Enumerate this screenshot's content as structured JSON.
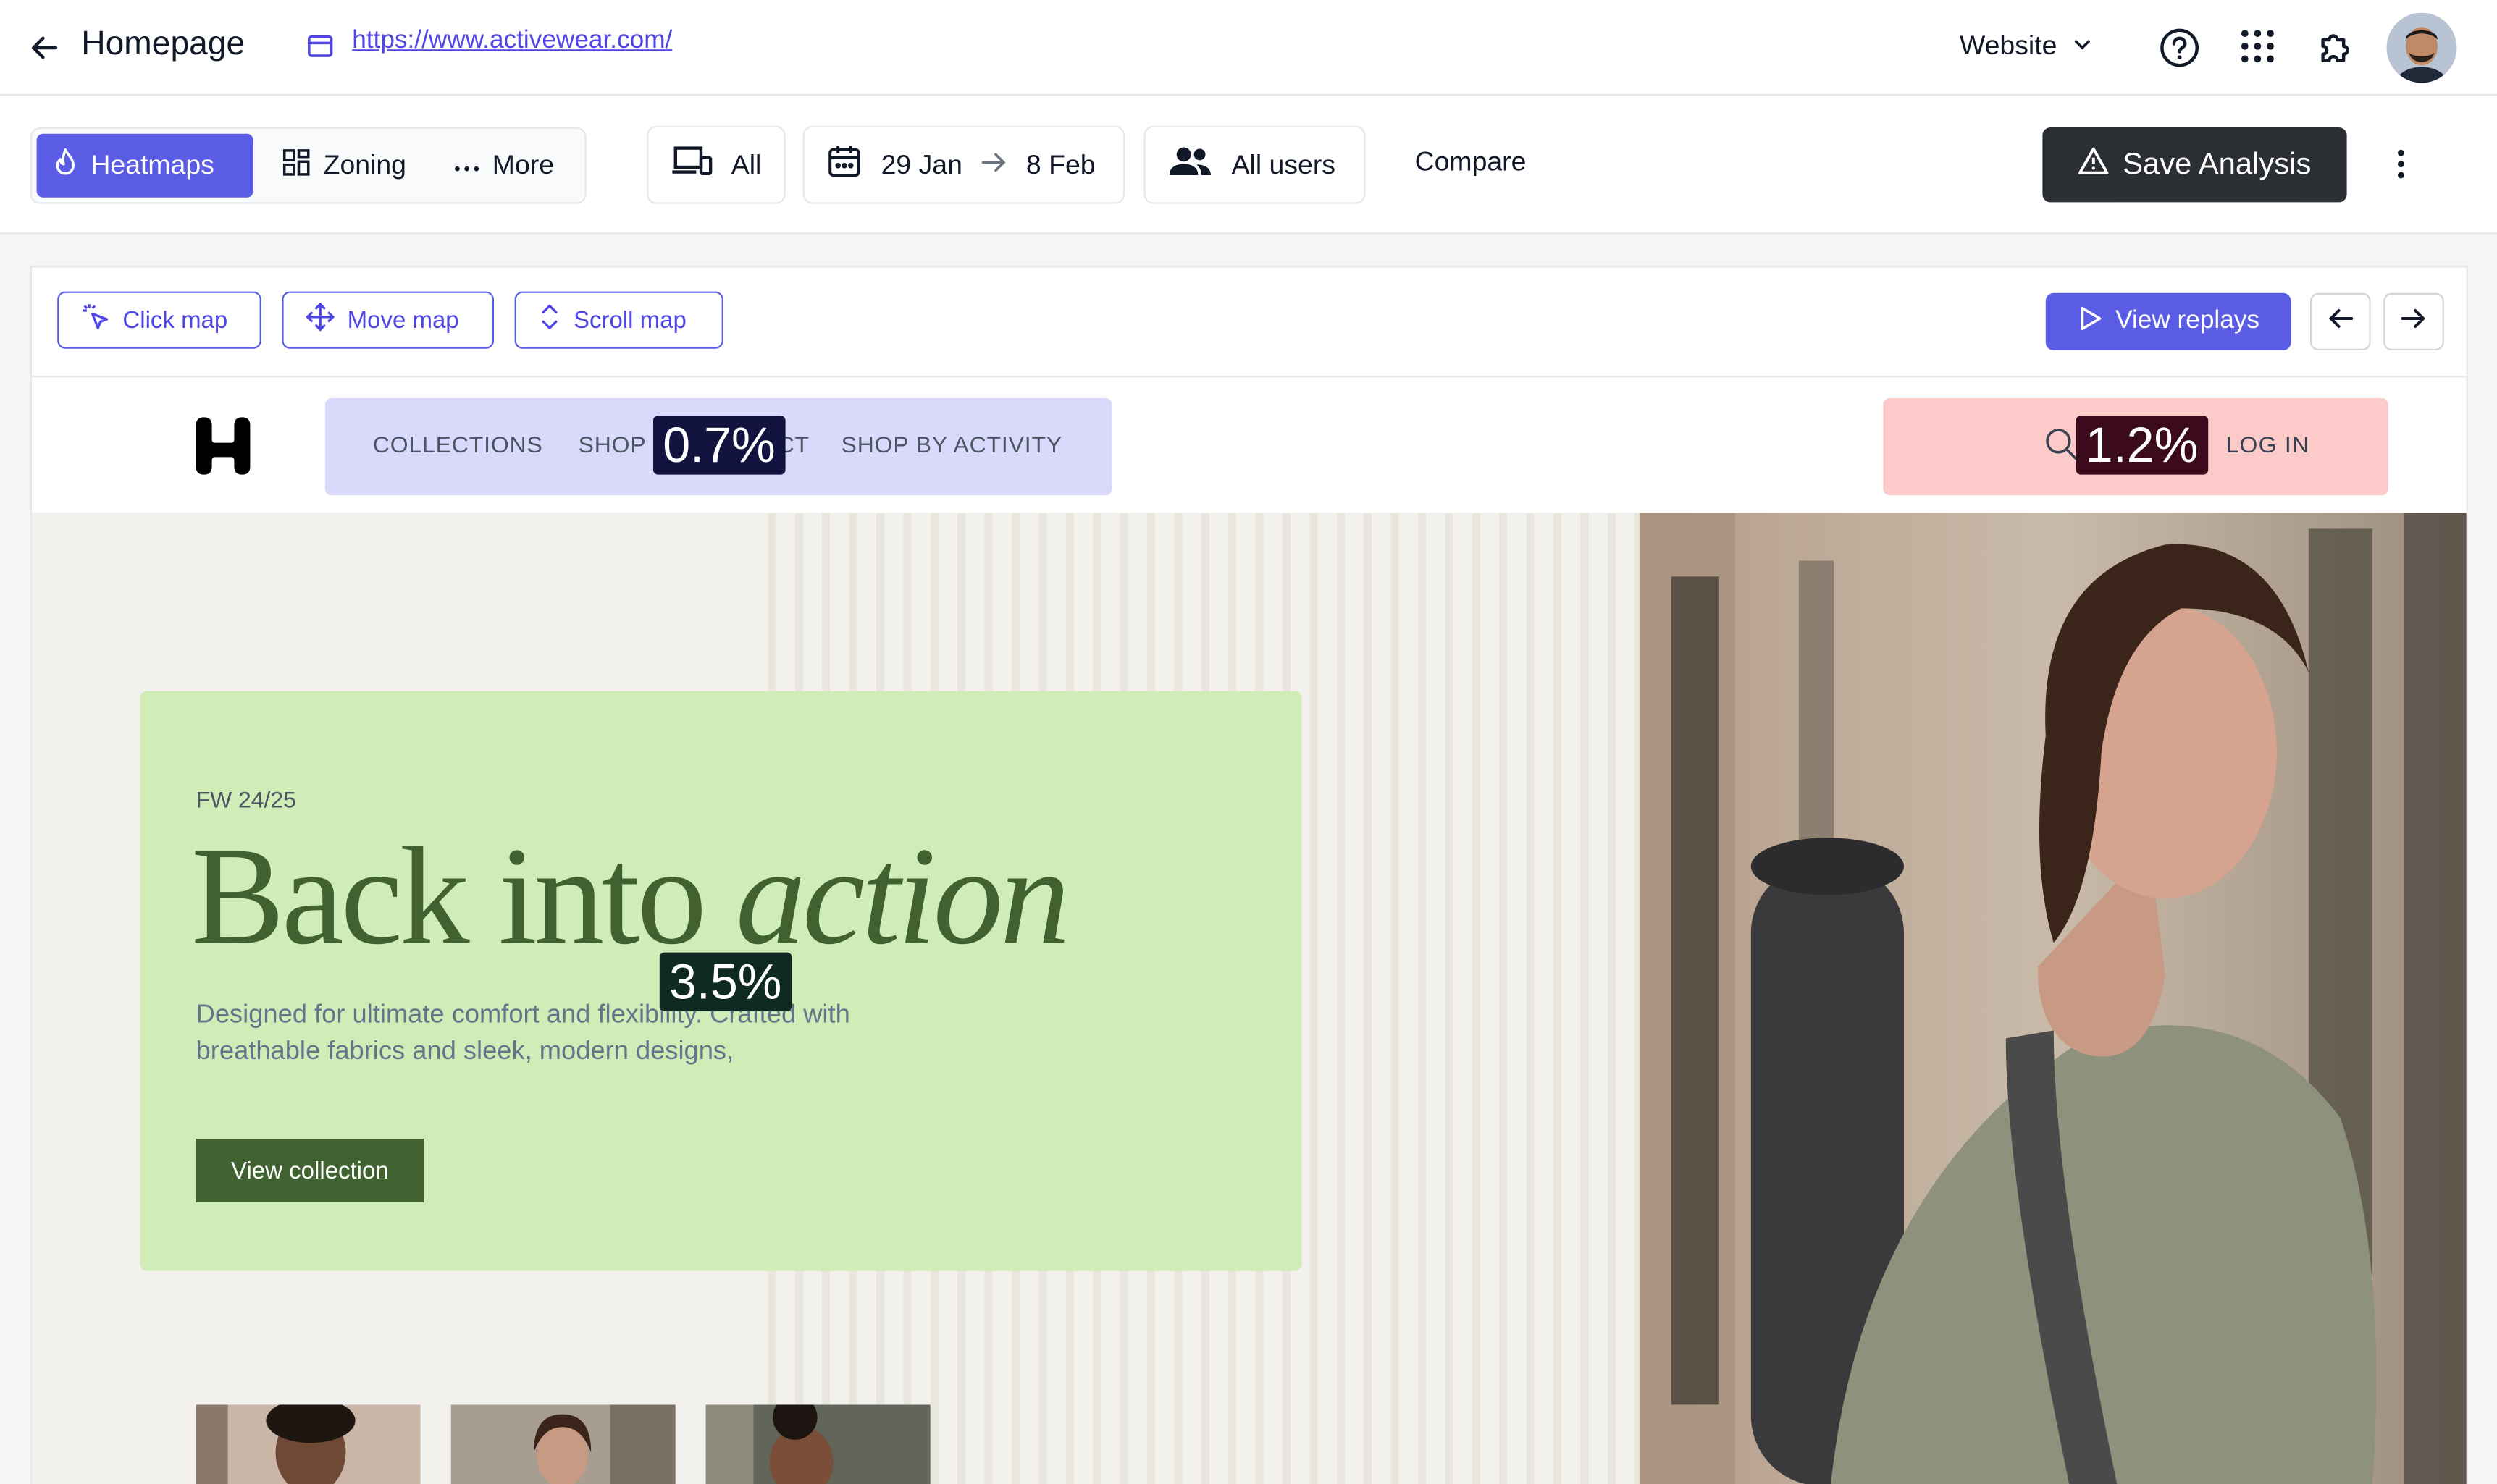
{
  "topbar": {
    "page_title": "Homepage",
    "url": "https://www.activewear.com/",
    "site_selector": "Website"
  },
  "toolbar": {
    "view_tabs": [
      {
        "label": "Heatmaps",
        "active": true
      },
      {
        "label": "Zoning",
        "active": false
      },
      {
        "label": "More",
        "active": false
      }
    ],
    "device_filter": "All",
    "date_start": "29 Jan",
    "date_end": "8 Feb",
    "segment_filter": "All users",
    "compare_label": "Compare",
    "save_label": "Save Analysis"
  },
  "heatmap_bar": {
    "modes": [
      {
        "label": "Click map"
      },
      {
        "label": "Move map"
      },
      {
        "label": "Scroll map"
      }
    ],
    "view_replays_label": "View replays"
  },
  "website": {
    "nav": {
      "items": [
        "COLLECTIONS",
        "SHOP",
        "CT",
        "SHOP BY ACTIVITY"
      ],
      "login_label": "LOG IN"
    },
    "hero": {
      "eyebrow": "FW 24/25",
      "headline_regular": "Back into",
      "headline_italic": "action",
      "subcopy": "Designed for ultimate comfort and flexibility. Crafted with breathable fabrics and sleek, modern designs,",
      "cta_label": "View collection"
    }
  },
  "heatmap_badges": [
    {
      "zone": "navigation",
      "value": "0.7%",
      "color": "#13133f"
    },
    {
      "zone": "login",
      "value": "1.2%",
      "color": "#3b0a1c"
    },
    {
      "zone": "hero",
      "value": "3.5%",
      "color": "#0e2a22"
    }
  ],
  "colors": {
    "accent": "#5b5ce6",
    "save_button": "#2b2f33",
    "hero_green": "#3f6230",
    "zone_nav": "#d8d9fb",
    "zone_login": "#fdcaca",
    "zone_hero": "#d1edb7"
  },
  "icons": {
    "back": "arrow-left-icon",
    "url": "browser-window-icon",
    "help": "question-circle-icon",
    "apps": "grid-dots-icon",
    "extensions": "puzzle-icon",
    "heatmaps": "flame-icon",
    "zoning": "zones-grid-icon",
    "more": "ellipsis-icon",
    "device": "devices-icon",
    "date": "calendar-icon",
    "users": "users-icon",
    "save": "warning-triangle-icon",
    "menu": "kebab-icon",
    "click_map": "cursor-click-icon",
    "move_map": "move-arrows-icon",
    "scroll_map": "scroll-vertical-icon",
    "replays": "play-icon",
    "prev": "arrow-left-icon",
    "next": "arrow-right-icon",
    "search": "search-icon"
  }
}
